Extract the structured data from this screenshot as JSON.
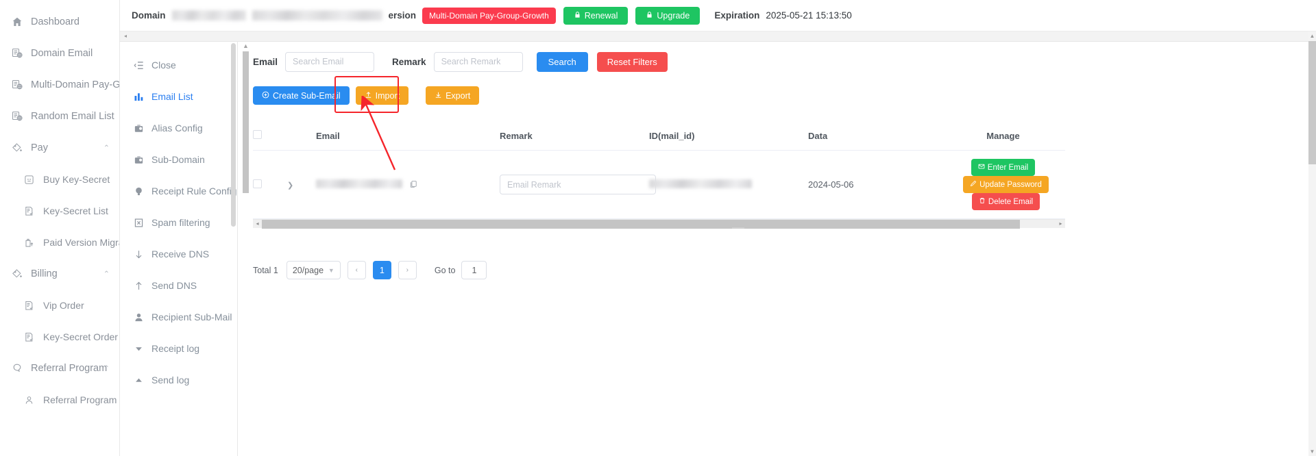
{
  "sidebar": {
    "items": [
      {
        "label": "Dashboard",
        "icon": "home-icon",
        "level": 0,
        "expandable": false
      },
      {
        "label": "Domain Email",
        "icon": "domain-email-icon",
        "level": 0,
        "expandable": false
      },
      {
        "label": "Multi-Domain Pay-Group",
        "icon": "domain-email-icon",
        "level": 0,
        "expandable": false
      },
      {
        "label": "Random Email List",
        "icon": "domain-email-icon",
        "level": 0,
        "expandable": false
      },
      {
        "label": "Pay",
        "icon": "pay-icon",
        "level": 0,
        "expandable": true,
        "arrow": "⌃"
      },
      {
        "label": "Buy Key-Secret",
        "icon": "buy-key-icon",
        "level": 1,
        "expandable": false
      },
      {
        "label": "Key-Secret List",
        "icon": "list-doc-icon",
        "level": 1,
        "expandable": false
      },
      {
        "label": "Paid Version Migration",
        "icon": "migration-icon",
        "level": 1,
        "expandable": false
      },
      {
        "label": "Billing",
        "icon": "pay-icon",
        "level": 0,
        "expandable": true,
        "arrow": "⌃"
      },
      {
        "label": "Vip Order",
        "icon": "list-doc-icon",
        "level": 1,
        "expandable": false
      },
      {
        "label": "Key-Secret Order",
        "icon": "list-doc-icon",
        "level": 1,
        "expandable": false
      },
      {
        "label": "Referral Program",
        "icon": "referral-icon",
        "level": 0,
        "expandable": true,
        "arrow": "⌃"
      },
      {
        "label": "Referral Program",
        "icon": "referral-sub-icon",
        "level": 1,
        "expandable": false
      }
    ]
  },
  "header": {
    "domain_label": "Domain",
    "version_label": "ersion",
    "plan_tag": "Multi-Domain Pay-Group-Growth",
    "renewal_label": "Renewal",
    "upgrade_label": "Upgrade",
    "expiration_label": "Expiration",
    "expiration_value": "2025-05-21 15:13:50",
    "colors": {
      "tag_red": "#fb3b4e",
      "green": "#1ec562"
    }
  },
  "second_menu": {
    "items": [
      {
        "label": "Close",
        "icon": "collapse-menu-icon",
        "active": false
      },
      {
        "label": "Email List",
        "icon": "bar-chart-icon",
        "active": true
      },
      {
        "label": "Alias Config",
        "icon": "briefcase-icon",
        "active": false
      },
      {
        "label": "Sub-Domain",
        "icon": "briefcase-icon",
        "active": false
      },
      {
        "label": "Receipt Rule Config",
        "icon": "bulb-icon",
        "active": false
      },
      {
        "label": "Spam filtering",
        "icon": "spam-icon",
        "active": false
      },
      {
        "label": "Receive DNS",
        "icon": "arrow-down-icon",
        "active": false
      },
      {
        "label": "Send DNS",
        "icon": "arrow-up-icon",
        "active": false
      },
      {
        "label": "Recipient Sub-Mail",
        "icon": "user-icon",
        "active": false
      },
      {
        "label": "Receipt log",
        "icon": "caret-down-icon",
        "active": false
      },
      {
        "label": "Send log",
        "icon": "caret-up-icon",
        "active": false
      }
    ]
  },
  "filters": {
    "email_label": "Email",
    "email_placeholder": "Search Email",
    "email_value": "",
    "remark_label": "Remark",
    "remark_placeholder": "Search Remark",
    "remark_value": "",
    "search_label": "Search",
    "reset_label": "Reset Filters"
  },
  "actions": {
    "create_label": "Create Sub-Email",
    "import_label": "Import",
    "export_label": "Export",
    "highlighted": "Import"
  },
  "table": {
    "columns": [
      "",
      "",
      "Email",
      "Remark",
      "ID(mail_id)",
      "Data",
      "Manage"
    ],
    "rows": [
      {
        "checkbox": false,
        "email": "",
        "remark_placeholder": "Email Remark",
        "remark_value": "",
        "mail_id": "",
        "date": "2024-05-06",
        "manage": [
          "Enter Email",
          "Update Password",
          "Delete Email"
        ]
      }
    ]
  },
  "pagination": {
    "total_label": "Total 1",
    "page_size": "20/page",
    "prev": "‹",
    "current_page": "1",
    "next": "›",
    "goto_label": "Go to",
    "goto_value": "1"
  }
}
